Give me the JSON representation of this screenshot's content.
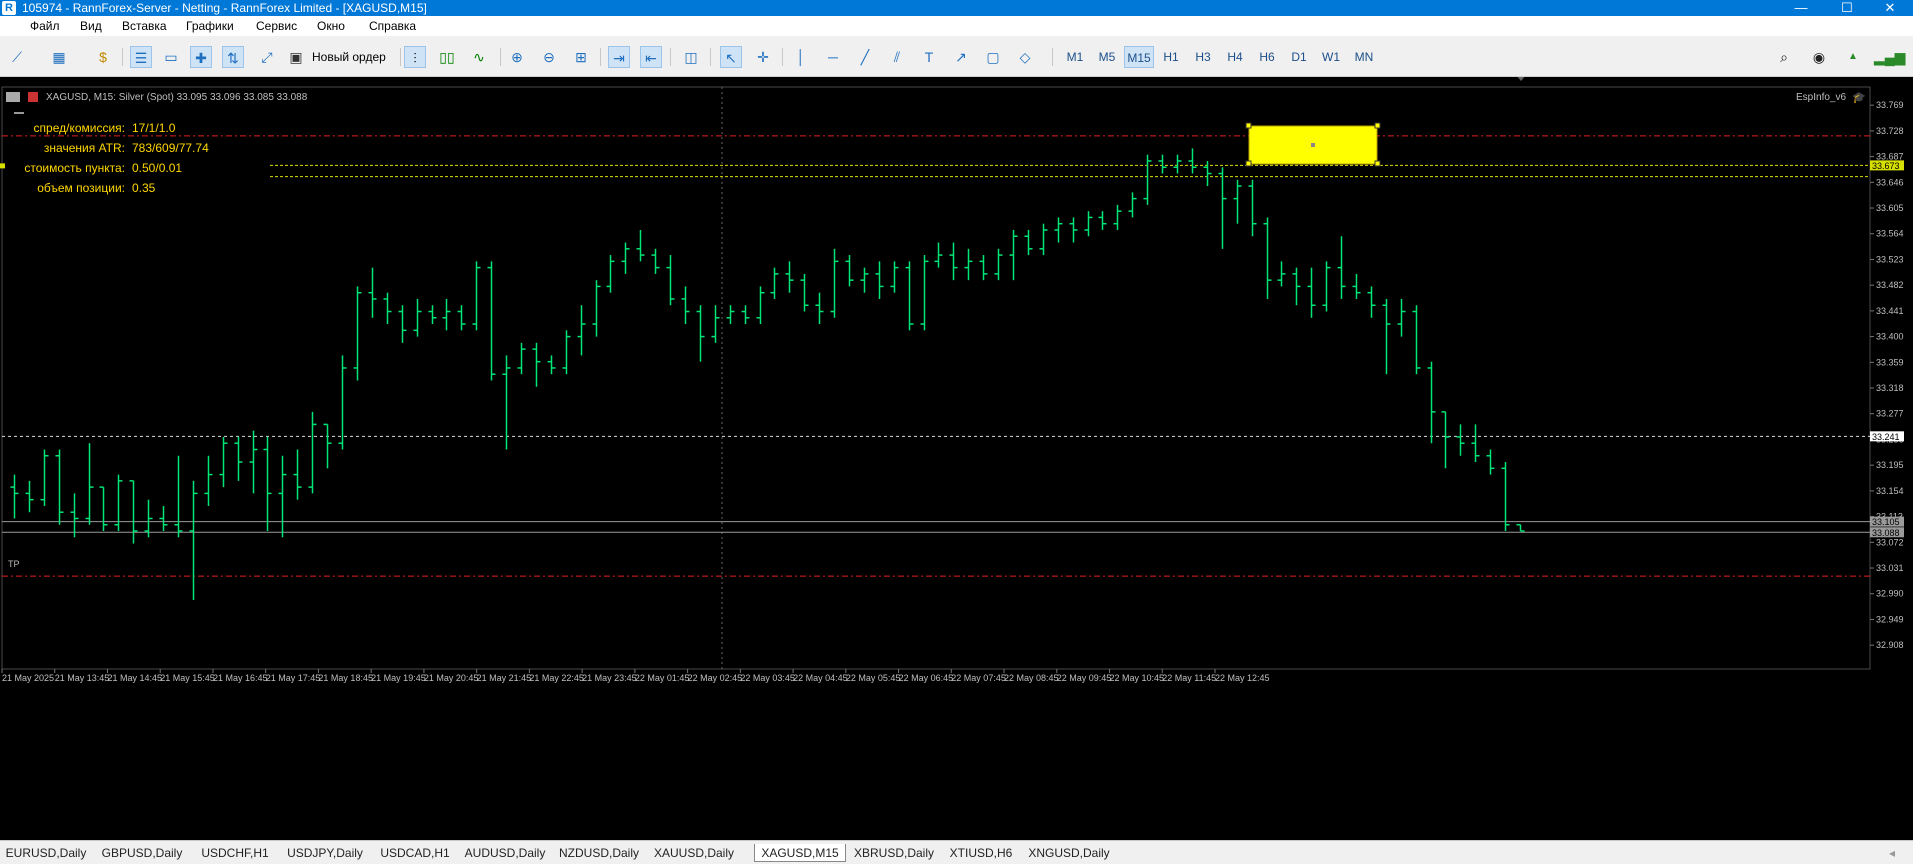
{
  "window": {
    "title": "105974 - RannForex-Server - Netting - RannForex Limited - [XAGUSD,M15]",
    "app_icon": "R",
    "minimize_glyph": "—",
    "maximize_glyph": "☐",
    "close_glyph": "✕"
  },
  "menu": [
    "Файл",
    "Вид",
    "Вставка",
    "Графики",
    "Сервис",
    "Окно",
    "Справка"
  ],
  "toolbar": {
    "new_order_label": "Новый ордер",
    "timeframes": [
      "M1",
      "M5",
      "M15",
      "H1",
      "H3",
      "H4",
      "H6",
      "D1",
      "W1",
      "MN"
    ],
    "active_timeframe": "M15"
  },
  "chart": {
    "header": "XAGUSD, M15:  Silver (Spot)  33.095 33.096 33.085 33.088",
    "indicator_name": "EspInfo_v6",
    "bull_color": "#00e676",
    "info": [
      {
        "label": "спред/комиссия:",
        "value": "17/1/1.0"
      },
      {
        "label": "значения ATR:",
        "value": "783/609/77.74"
      },
      {
        "label": "стоимость пункта:",
        "value": "0.50/0.01"
      },
      {
        "label": "объем позиции:",
        "value": "0.35"
      }
    ],
    "tp_label": "TP",
    "price_ticks": [
      "33.769",
      "33.728",
      "33.687",
      "33.646",
      "33.605",
      "33.564",
      "33.523",
      "33.482",
      "33.441",
      "33.400",
      "33.359",
      "33.318",
      "33.277",
      "33.236",
      "33.195",
      "33.154",
      "33.113",
      "33.072",
      "33.031",
      "32.990",
      "32.949",
      "32.908"
    ],
    "price_labels": {
      "yellow": "33.673",
      "white_dotted": "33.241",
      "bid": "33.105",
      "ask": "33.088"
    },
    "time_labels": [
      "21 May 2025",
      "21 May 13:45",
      "21 May 14:45",
      "21 May 15:45",
      "21 May 16:45",
      "21 May 17:45",
      "21 May 18:45",
      "21 May 19:45",
      "21 May 20:45",
      "21 May 21:45",
      "21 May 22:45",
      "21 May 23:45",
      "22 May 01:45",
      "22 May 02:45",
      "22 May 03:45",
      "22 May 04:45",
      "22 May 05:45",
      "22 May 06:45",
      "22 May 07:45",
      "22 May 08:45",
      "22 May 09:45",
      "22 May 10:45",
      "22 May 11:45",
      "22 May 12:45"
    ]
  },
  "chart_data": {
    "type": "ohlc",
    "symbol": "XAGUSD",
    "timeframe": "M15",
    "ylim": [
      32.87,
      33.79
    ],
    "levels": {
      "red_upper": 33.72,
      "yellow_dashed_upper": 33.673,
      "yellow_dashed_lower": 33.655,
      "white_dotted": 33.241,
      "bid": 33.105,
      "ask": 33.088,
      "tp_red": 33.018
    },
    "bars": [
      [
        33.16,
        33.18,
        33.11,
        33.15
      ],
      [
        33.15,
        33.17,
        33.12,
        33.14
      ],
      [
        33.14,
        33.22,
        33.13,
        33.21
      ],
      [
        33.21,
        33.22,
        33.1,
        33.12
      ],
      [
        33.12,
        33.15,
        33.08,
        33.11
      ],
      [
        33.11,
        33.23,
        33.1,
        33.16
      ],
      [
        33.16,
        33.16,
        33.09,
        33.1
      ],
      [
        33.1,
        33.18,
        33.09,
        33.17
      ],
      [
        33.17,
        33.17,
        33.07,
        33.09
      ],
      [
        33.09,
        33.14,
        33.08,
        33.11
      ],
      [
        33.11,
        33.13,
        33.09,
        33.1
      ],
      [
        33.1,
        33.21,
        33.08,
        33.09
      ],
      [
        33.09,
        33.17,
        32.98,
        33.15
      ],
      [
        33.15,
        33.21,
        33.13,
        33.18
      ],
      [
        33.18,
        33.24,
        33.16,
        33.23
      ],
      [
        33.23,
        33.24,
        33.17,
        33.2
      ],
      [
        33.2,
        33.25,
        33.15,
        33.22
      ],
      [
        33.22,
        33.24,
        33.09,
        33.15
      ],
      [
        33.15,
        33.21,
        33.08,
        33.18
      ],
      [
        33.18,
        33.22,
        33.14,
        33.16
      ],
      [
        33.16,
        33.28,
        33.15,
        33.26
      ],
      [
        33.26,
        33.26,
        33.19,
        33.23
      ],
      [
        33.23,
        33.37,
        33.22,
        33.35
      ],
      [
        33.35,
        33.48,
        33.33,
        33.47
      ],
      [
        33.47,
        33.51,
        33.43,
        33.46
      ],
      [
        33.46,
        33.47,
        33.42,
        33.44
      ],
      [
        33.44,
        33.45,
        33.39,
        33.41
      ],
      [
        33.41,
        33.46,
        33.4,
        33.44
      ],
      [
        33.44,
        33.45,
        33.42,
        33.43
      ],
      [
        33.43,
        33.46,
        33.41,
        33.44
      ],
      [
        33.44,
        33.45,
        33.41,
        33.42
      ],
      [
        33.42,
        33.52,
        33.41,
        33.51
      ],
      [
        33.51,
        33.52,
        33.33,
        33.34
      ],
      [
        33.34,
        33.37,
        33.22,
        33.35
      ],
      [
        33.35,
        33.39,
        33.34,
        33.38
      ],
      [
        33.38,
        33.39,
        33.32,
        33.36
      ],
      [
        33.36,
        33.37,
        33.34,
        33.35
      ],
      [
        33.35,
        33.41,
        33.34,
        33.4
      ],
      [
        33.4,
        33.45,
        33.37,
        33.42
      ],
      [
        33.42,
        33.49,
        33.4,
        33.48
      ],
      [
        33.48,
        33.53,
        33.47,
        33.52
      ],
      [
        33.52,
        33.55,
        33.5,
        33.54
      ],
      [
        33.54,
        33.57,
        33.52,
        33.53
      ],
      [
        33.53,
        33.54,
        33.5,
        33.51
      ],
      [
        33.51,
        33.53,
        33.45,
        33.46
      ],
      [
        33.46,
        33.48,
        33.42,
        33.44
      ],
      [
        33.44,
        33.45,
        33.36,
        33.4
      ],
      [
        33.4,
        33.45,
        33.39,
        33.43
      ],
      [
        33.43,
        33.45,
        33.42,
        33.44
      ],
      [
        33.44,
        33.45,
        33.42,
        33.43
      ],
      [
        33.43,
        33.48,
        33.42,
        33.47
      ],
      [
        33.47,
        33.51,
        33.46,
        33.5
      ],
      [
        33.5,
        33.52,
        33.47,
        33.49
      ],
      [
        33.49,
        33.5,
        33.44,
        33.45
      ],
      [
        33.45,
        33.47,
        33.42,
        33.44
      ],
      [
        33.44,
        33.54,
        33.43,
        33.52
      ],
      [
        33.52,
        33.53,
        33.48,
        33.49
      ],
      [
        33.49,
        33.51,
        33.47,
        33.5
      ],
      [
        33.5,
        33.52,
        33.46,
        33.48
      ],
      [
        33.48,
        33.52,
        33.47,
        33.51
      ],
      [
        33.51,
        33.52,
        33.41,
        33.42
      ],
      [
        33.42,
        33.53,
        33.41,
        33.52
      ],
      [
        33.52,
        33.55,
        33.51,
        33.53
      ],
      [
        33.53,
        33.55,
        33.49,
        33.51
      ],
      [
        33.51,
        33.54,
        33.49,
        33.52
      ],
      [
        33.52,
        33.53,
        33.49,
        33.5
      ],
      [
        33.5,
        33.54,
        33.49,
        33.53
      ],
      [
        33.53,
        33.57,
        33.49,
        33.56
      ],
      [
        33.56,
        33.57,
        33.53,
        33.54
      ],
      [
        33.54,
        33.58,
        33.53,
        33.57
      ],
      [
        33.57,
        33.59,
        33.55,
        33.58
      ],
      [
        33.58,
        33.59,
        33.55,
        33.57
      ],
      [
        33.57,
        33.6,
        33.56,
        33.59
      ],
      [
        33.59,
        33.6,
        33.57,
        33.58
      ],
      [
        33.58,
        33.61,
        33.57,
        33.6
      ],
      [
        33.6,
        33.63,
        33.59,
        33.62
      ],
      [
        33.62,
        33.69,
        33.61,
        33.68
      ],
      [
        33.68,
        33.69,
        33.66,
        33.67
      ],
      [
        33.67,
        33.69,
        33.66,
        33.68
      ],
      [
        33.68,
        33.7,
        33.66,
        33.67
      ],
      [
        33.67,
        33.68,
        33.64,
        33.66
      ],
      [
        33.66,
        33.67,
        33.54,
        33.62
      ],
      [
        33.62,
        33.65,
        33.58,
        33.64
      ],
      [
        33.64,
        33.65,
        33.56,
        33.58
      ],
      [
        33.58,
        33.59,
        33.46,
        33.49
      ],
      [
        33.49,
        33.52,
        33.48,
        33.5
      ],
      [
        33.5,
        33.51,
        33.45,
        33.48
      ],
      [
        33.48,
        33.51,
        33.43,
        33.45
      ],
      [
        33.45,
        33.52,
        33.44,
        33.51
      ],
      [
        33.51,
        33.56,
        33.46,
        33.48
      ],
      [
        33.48,
        33.5,
        33.46,
        33.47
      ],
      [
        33.47,
        33.48,
        33.43,
        33.45
      ],
      [
        33.45,
        33.46,
        33.34,
        33.42
      ],
      [
        33.42,
        33.46,
        33.4,
        33.44
      ],
      [
        33.44,
        33.45,
        33.34,
        33.35
      ],
      [
        33.35,
        33.36,
        33.23,
        33.28
      ],
      [
        33.28,
        33.28,
        33.19,
        33.24
      ],
      [
        33.24,
        33.26,
        33.21,
        33.23
      ],
      [
        33.23,
        33.26,
        33.2,
        33.21
      ],
      [
        33.21,
        33.22,
        33.18,
        33.19
      ],
      [
        33.19,
        33.2,
        33.09,
        33.1
      ],
      [
        33.1,
        33.1,
        33.09,
        33.09
      ]
    ]
  },
  "tabs": [
    "EURUSD,Daily",
    "GBPUSD,Daily",
    "USDCHF,H1",
    "USDJPY,Daily",
    "USDCAD,H1",
    "AUDUSD,Daily",
    "NZDUSD,Daily",
    "XAUUSD,Daily",
    "XAGUSD,M15",
    "XBRUSD,Daily",
    "XTIUSD,H6",
    "XNGUSD,Daily"
  ],
  "active_tab": "XAGUSD,M15"
}
